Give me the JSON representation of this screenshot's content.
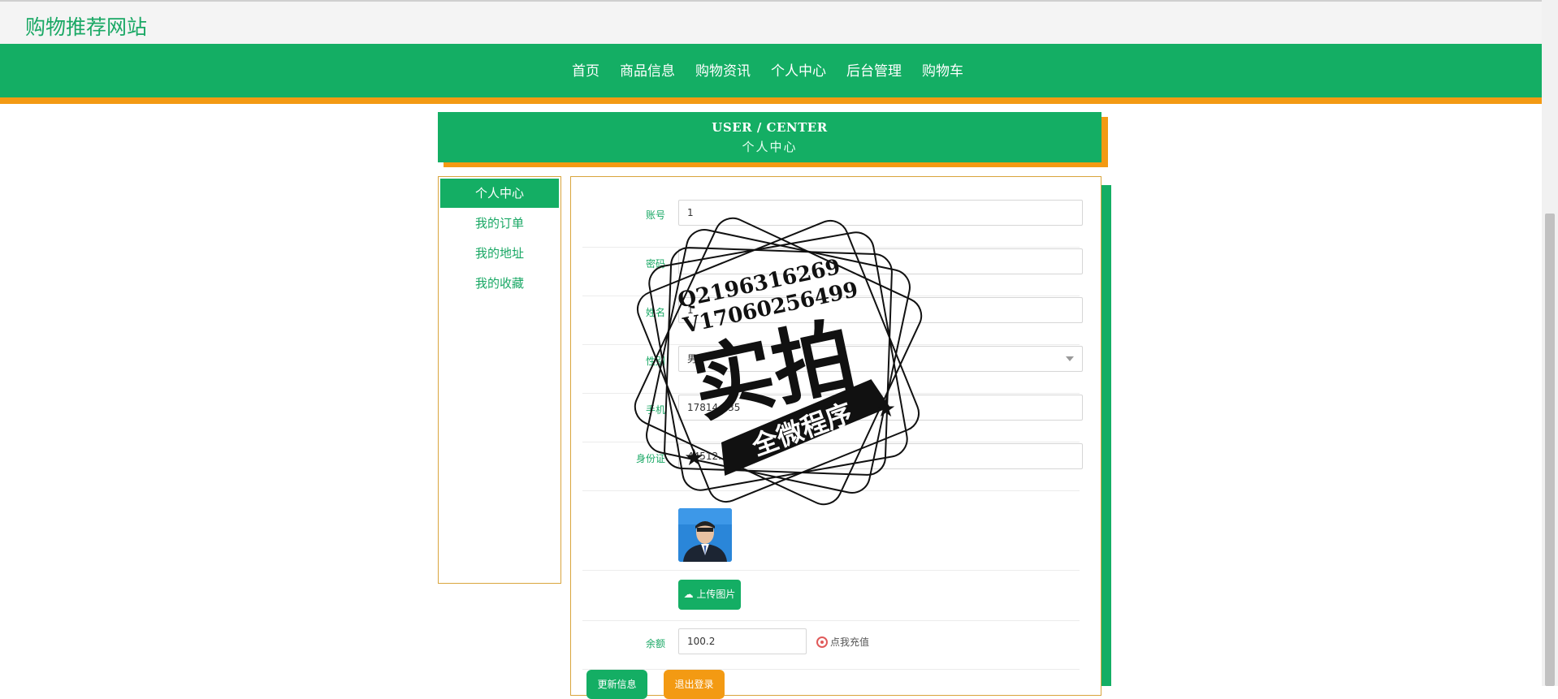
{
  "header": {
    "site_title": "购物推荐网站"
  },
  "nav": {
    "items": [
      {
        "label": "首页"
      },
      {
        "label": "商品信息"
      },
      {
        "label": "购物资讯"
      },
      {
        "label": "个人中心"
      },
      {
        "label": "后台管理"
      },
      {
        "label": "购物车"
      }
    ]
  },
  "banner": {
    "title_en": "USER / CENTER",
    "title_cn": "个人中心"
  },
  "sidebar": {
    "items": [
      {
        "label": "个人中心",
        "active": true
      },
      {
        "label": "我的订单"
      },
      {
        "label": "我的地址"
      },
      {
        "label": "我的收藏"
      }
    ]
  },
  "form": {
    "account": {
      "label": "账号",
      "value": "1"
    },
    "password": {
      "label": "密码",
      "value": "·"
    },
    "name": {
      "label": "姓名",
      "value": "1"
    },
    "gender": {
      "label": "性别",
      "value": "男"
    },
    "phone": {
      "label": "手机",
      "value": "17814…35"
    },
    "id_card": {
      "label": "身份证",
      "value": "44512…595…"
    },
    "upload_label": "上传图片",
    "balance": {
      "label": "余额",
      "value": "100.2"
    },
    "recharge_label": "点我充值",
    "update_label": "更新信息",
    "logout_label": "退出登录"
  },
  "watermark": {
    "line1": "Q2196316269",
    "line2": "V17060256499",
    "big_text": "实拍",
    "ribbon_text": "全微程序"
  },
  "colors": {
    "green": "#14ae64",
    "orange": "#f39a13",
    "text_green": "#1aa865"
  }
}
